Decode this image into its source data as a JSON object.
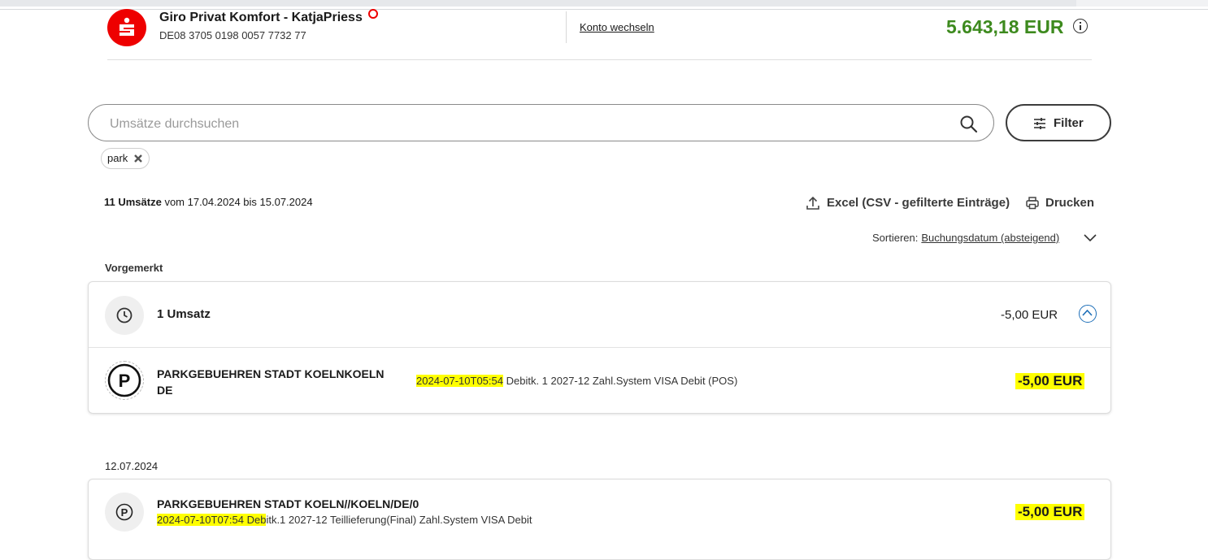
{
  "account": {
    "name": "Giro Privat Komfort - KatjaPriess",
    "iban": "DE08 3705 0198 0057 7732 77",
    "switch_label": "Konto wechseln",
    "balance": "5.643,18 EUR",
    "brand_color": "#ee0000",
    "balance_color": "#3d8a1e"
  },
  "search": {
    "placeholder": "Umsätze durchsuchen",
    "value": "",
    "filter_label": "Filter"
  },
  "chips": [
    {
      "label": "park"
    }
  ],
  "summary": {
    "count_bold": "11 Umsätze",
    "range": " vom 17.04.2024 bis 15.07.2024"
  },
  "actions": {
    "export_label": "Excel (CSV - gefilterte Einträge)",
    "print_label": "Drucken"
  },
  "sort": {
    "label": "Sortieren:",
    "value": "Buchungsdatum (absteigend)"
  },
  "sections": [
    {
      "label": "Vorgemerkt",
      "group": {
        "title": "1 Umsatz",
        "amount": "-5,00 EUR",
        "icon": "clock-icon"
      },
      "transactions": [
        {
          "name_line1": "PARKGEBUEHREN STADT KOELNKOELN",
          "name_line2": "DE",
          "detail_highlight": "2024-07-10T05:54",
          "detail_rest": " Debitk. 1 2027-12 Zahl.System VISA Debit (POS)",
          "amount": "-5,00 EUR",
          "icon": "parking-icon"
        }
      ]
    },
    {
      "label": "12.07.2024",
      "transactions": [
        {
          "name_line1": "PARKGEBUEHREN STADT KOELN//KOELN/DE/0",
          "detail_highlight": "2024-07-10T07:54 Deb",
          "detail_rest": "itk.1 2027-12 Teillieferung(Final) Zahl.System VISA Debit",
          "amount": "-5,00 EUR",
          "icon": "parking-icon"
        }
      ]
    }
  ],
  "highlight_color": "#ffff00"
}
